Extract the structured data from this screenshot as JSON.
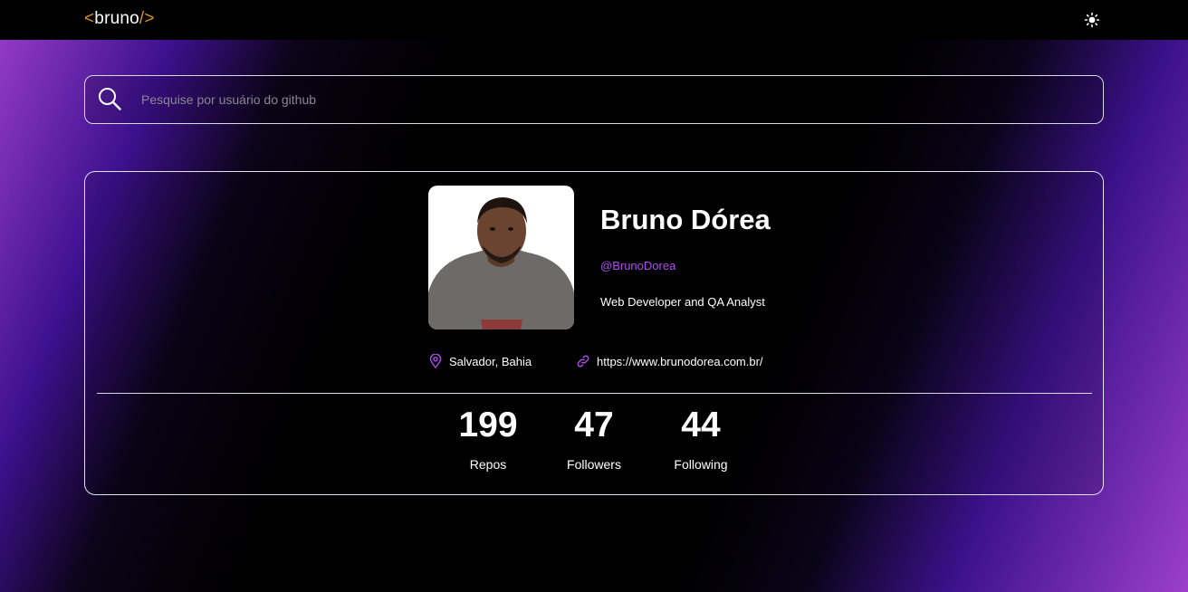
{
  "header": {
    "logo_open": "<",
    "logo_name": "bruno",
    "logo_close": "/>",
    "theme_icon": "sun-icon"
  },
  "search": {
    "placeholder": "Pesquise por usuário do github",
    "value": "",
    "icon": "search-icon"
  },
  "profile": {
    "name": "Bruno Dórea",
    "username": "@BrunoDorea",
    "bio": "Web Developer and QA Analyst",
    "location": "Salvador, Bahia",
    "website": "https://www.brunodorea.com.br/"
  },
  "stats": [
    {
      "value": "199",
      "label": "Repos"
    },
    {
      "value": "47",
      "label": "Followers"
    },
    {
      "value": "44",
      "label": "Following"
    }
  ],
  "colors": {
    "accent": "#b04cf0",
    "logo_bracket": "#d8922a",
    "gradient_edge": "#9c3fcb",
    "gradient_mid": "#3e1190",
    "background": "#000000"
  }
}
